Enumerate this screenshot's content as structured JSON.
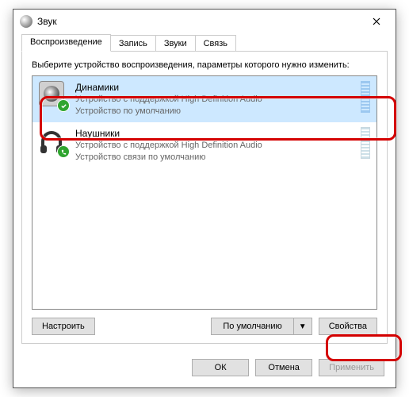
{
  "window": {
    "title": "Звук"
  },
  "tabs": {
    "playback": "Воспроизведение",
    "recording": "Запись",
    "sounds": "Звуки",
    "communications": "Связь"
  },
  "instruction": "Выберите устройство воспроизведения, параметры которого нужно изменить:",
  "devices": [
    {
      "name": "Динамики",
      "driver": "Устройство с поддержкой High Definition Audio",
      "status": "Устройство по умолчанию"
    },
    {
      "name": "Наушники",
      "driver": "Устройство с поддержкой High Definition Audio",
      "status": "Устройство связи по умолчанию"
    }
  ],
  "buttons": {
    "configure": "Настроить",
    "set_default": "По умолчанию",
    "properties": "Свойства",
    "ok": "ОК",
    "cancel": "Отмена",
    "apply": "Применить"
  }
}
